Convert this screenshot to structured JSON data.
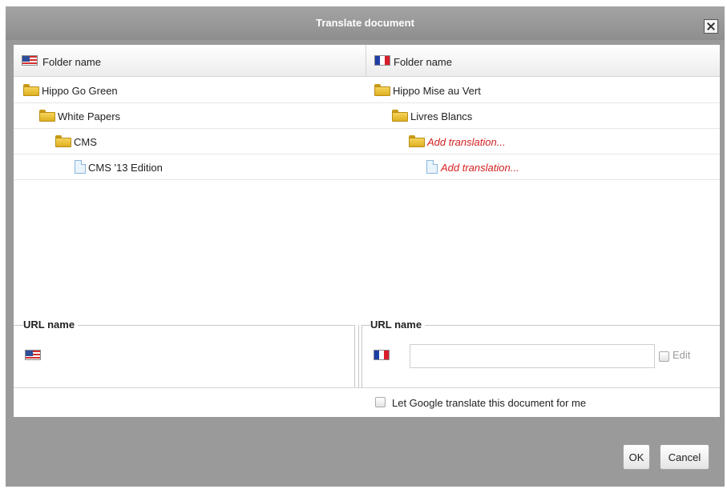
{
  "dialog": {
    "title": "Translate document"
  },
  "columns": {
    "left_header": "Folder name",
    "right_header": "Folder name",
    "left_flag": "us-flag-icon",
    "right_flag": "fr-flag-icon"
  },
  "tree_left": [
    {
      "label": "Hippo Go Green",
      "icon": "folder-icon"
    },
    {
      "label": "White Papers",
      "icon": "folder-icon"
    },
    {
      "label": "CMS",
      "icon": "folder-icon"
    },
    {
      "label": "CMS '13 Edition",
      "icon": "document-icon"
    }
  ],
  "tree_right": [
    {
      "label": "Hippo Mise au Vert",
      "icon": "folder-icon"
    },
    {
      "label": "Livres Blancs",
      "icon": "folder-icon"
    },
    {
      "label": "Add translation...",
      "icon": "folder-icon",
      "is_link": true
    },
    {
      "label": "Add translation...",
      "icon": "document-icon",
      "is_link": true
    }
  ],
  "url_section": {
    "left_legend": "URL name",
    "right_legend": "URL name",
    "url_value": "",
    "edit_label": "Edit",
    "edit_checked": false
  },
  "google_translate": {
    "label": "Let Google translate this document for me",
    "checked": false
  },
  "footer": {
    "ok_label": "OK",
    "cancel_label": "Cancel"
  },
  "colors": {
    "title_bar": "#9a9a9a",
    "link_red": "#d31f1f",
    "folder_yellow": "#f0c53c"
  }
}
